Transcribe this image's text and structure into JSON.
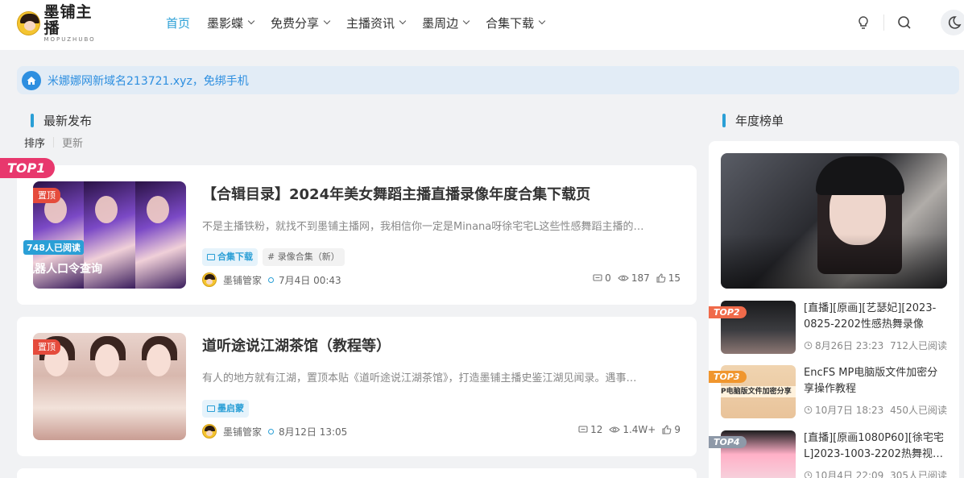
{
  "site": {
    "logo_cn": "墨铺主播",
    "logo_en": "MOPUZHUBO"
  },
  "nav": {
    "items": [
      {
        "label": "首页",
        "active": true,
        "has_dropdown": false
      },
      {
        "label": "墨影蝶",
        "active": false,
        "has_dropdown": true
      },
      {
        "label": "免费分享",
        "active": false,
        "has_dropdown": true
      },
      {
        "label": "主播资讯",
        "active": false,
        "has_dropdown": true
      },
      {
        "label": "墨周边",
        "active": false,
        "has_dropdown": true
      },
      {
        "label": "合集下载",
        "active": false,
        "has_dropdown": true
      }
    ],
    "right_icons": [
      "lightbulb-icon",
      "search-icon",
      "moon-icon"
    ]
  },
  "notice": {
    "icon": "home-icon",
    "text": "米娜娜网新域名213721.xyz，免绑手机"
  },
  "latest": {
    "title": "最新发布",
    "sort_tabs": [
      "排序",
      "更新"
    ]
  },
  "posts": [
    {
      "badge": "置顶",
      "title": "【合辑目录】2024年美女舞蹈主播直播录像年度合集下载页",
      "excerpt": "不是主播铁粉，就找不到墨铺主播网，我相信你一定是Minana呀徐宅宅L这些性感舞蹈主播的…",
      "tags": [
        {
          "label": "合集下载",
          "kind": "category"
        },
        {
          "label": "# 录像合集（新）",
          "kind": "topic"
        }
      ],
      "author": "墨铺管家",
      "date": "7月4日 00:43",
      "comments": "0",
      "views": "187",
      "likes": "15"
    },
    {
      "badge": "置顶",
      "title": "道听途说江湖茶馆（教程等）",
      "excerpt": "有人的地方就有江湖，置顶本贴《道听途说江湖茶馆》，打造墨铺主播史鉴江湖见闻录。遇事…",
      "tags": [
        {
          "label": "墨启蒙",
          "kind": "category"
        }
      ],
      "author": "墨铺管家",
      "date": "8月12日 13:05",
      "comments": "12",
      "views": "1.4W+",
      "likes": "9"
    }
  ],
  "yearly": {
    "title": "年度榜单",
    "top1": {
      "rank": "TOP1",
      "reads": "748人已阅读",
      "title": "机器人口令查询"
    },
    "items": [
      {
        "rank": "TOP2",
        "rank_color": "#f06a4a",
        "title": "[直播][原画][艺瑟妃][2023-0825-2202性感热舞录像",
        "date": "8月26日 23:23",
        "reads": "712人已阅读"
      },
      {
        "rank": "TOP3",
        "rank_color": "#f0962e",
        "title": "EncFS MP电脑版文件加密分享操作教程",
        "thumb_text": "P电脑版文件加密分享",
        "date": "10月7日 18:23",
        "reads": "450人已阅读"
      },
      {
        "rank": "TOP4",
        "rank_color": "#8e99a8",
        "title": "[直播][原画1080P60][徐宅宅L]2023-1003-2202热舞视…",
        "date": "10月4日 22:09",
        "reads": "305人已阅读"
      }
    ]
  },
  "colors": {
    "accent": "#2a9fd6",
    "pin_badge": "#e54b3c",
    "top1_badge": "#e8386d",
    "notice_bg": "#e2ecf6",
    "page_bg": "#f1f2f4"
  }
}
